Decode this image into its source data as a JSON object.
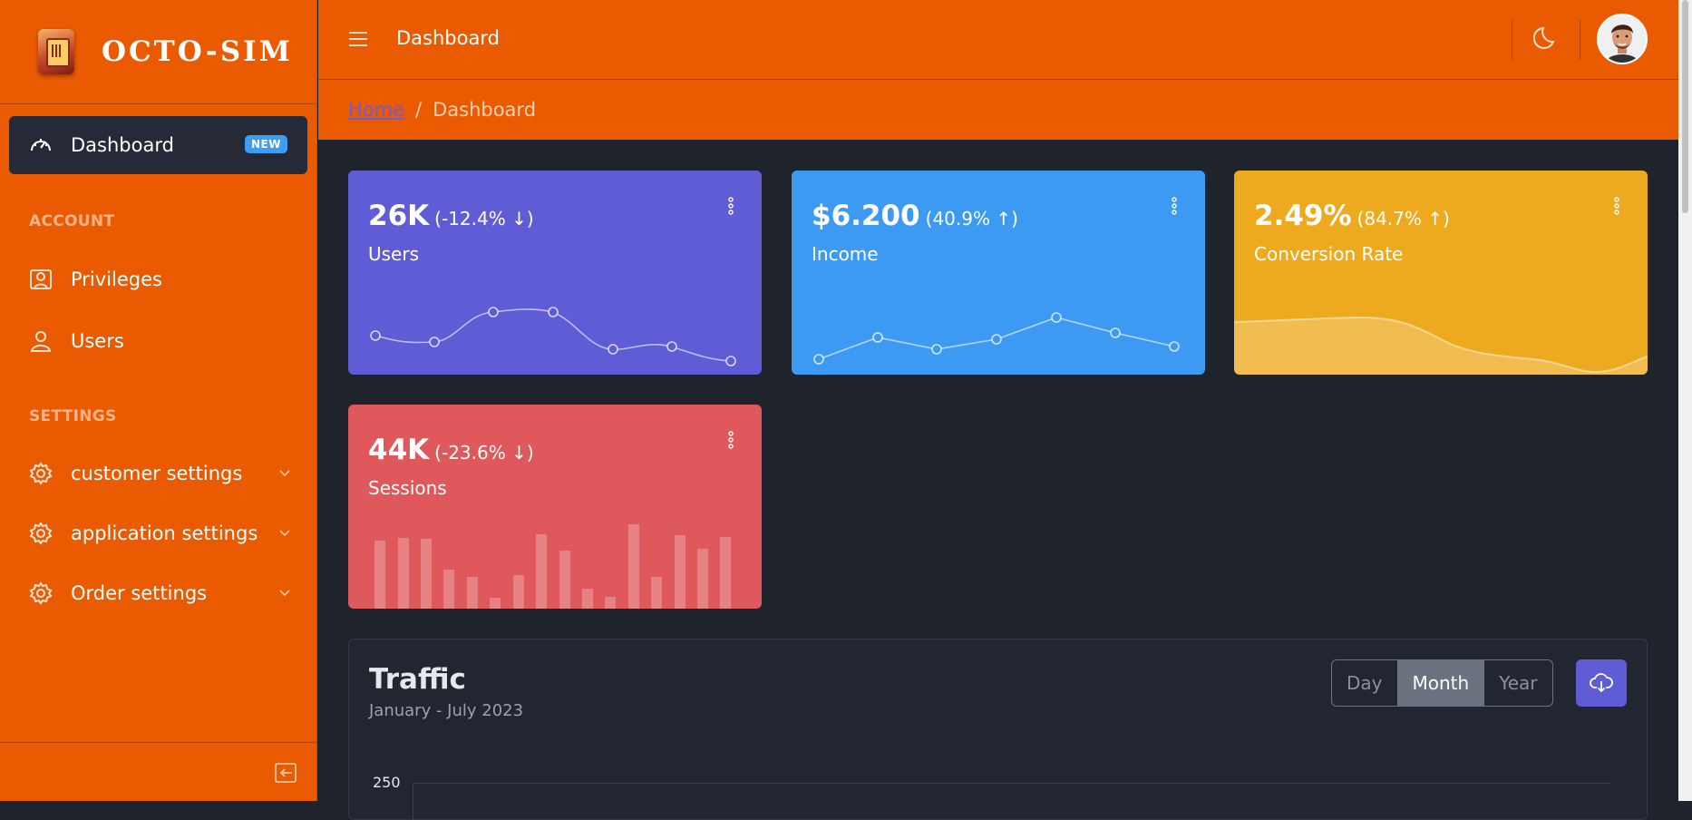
{
  "brand": {
    "name": "OCTO-SIM"
  },
  "sidebar": {
    "active_item": {
      "label": "Dashboard",
      "badge": "NEW",
      "icon": "speedometer-icon"
    },
    "sections": [
      {
        "title": "ACCOUNT",
        "items": [
          {
            "label": "Privileges",
            "icon": "id-badge-icon"
          },
          {
            "label": "Users",
            "icon": "user-icon"
          }
        ]
      },
      {
        "title": "SETTINGS",
        "items": [
          {
            "label": "customer settings",
            "icon": "gear-icon"
          },
          {
            "label": "application settings",
            "icon": "gear-icon"
          },
          {
            "label": "Order settings",
            "icon": "gear-icon"
          }
        ]
      }
    ]
  },
  "header": {
    "title": "Dashboard"
  },
  "breadcrumb": {
    "home": "Home",
    "separator": "/",
    "current": "Dashboard"
  },
  "cards": {
    "users": {
      "value": "26K",
      "delta": "(-12.4% ↓)",
      "caption": "Users",
      "color": "#5f5cd5"
    },
    "income": {
      "value": "$6.200",
      "delta": "(40.9% ↑)",
      "caption": "Income",
      "color": "#3c9af3"
    },
    "conversion": {
      "value": "2.49%",
      "delta": "(84.7% ↑)",
      "caption": "Conversion Rate",
      "color": "#edaa1f"
    },
    "sessions": {
      "value": "44K",
      "delta": "(-23.6% ↓)",
      "caption": "Sessions",
      "color": "#df585b"
    }
  },
  "traffic": {
    "title": "Traffic",
    "subtitle": "January - July 2023",
    "periods": [
      "Day",
      "Month",
      "Year"
    ],
    "selected_period": "Month",
    "y_top_tick": "250"
  },
  "colors": {
    "accent": "#ea5a00",
    "dark_bg": "#1f232b",
    "primary": "#5f5cd5"
  }
}
